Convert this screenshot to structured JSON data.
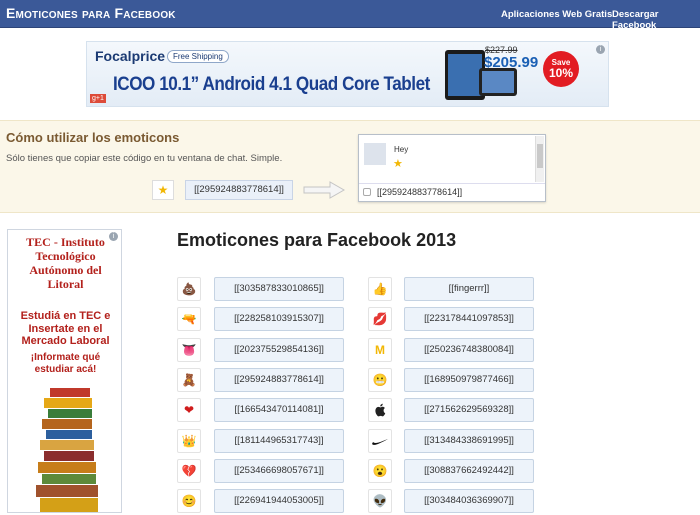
{
  "header": {
    "logo": "Emoticones para Facebook",
    "nav": [
      "Aplicaciones Web Gratis",
      "Descargar Facebook"
    ]
  },
  "banner_ad": {
    "brand": "Focalprice",
    "shipping": "Free Shipping",
    "headline": "ICOO 10.1” Android 4.1 Quad Core Tablet",
    "price_old": "$227.99",
    "price_new": "$205.99",
    "save_label": "Save",
    "save_value": "10%",
    "gplus": "g+1"
  },
  "howto": {
    "title": "Cómo utilizar los emoticons",
    "subtitle": "Sólo tienes que copiar este código en tu ventana de chat. Simple.",
    "demo_code": "[[295924883778614]]",
    "chat_name": "Hey",
    "chat_input": "[[295924883778614]]"
  },
  "side_ad": {
    "title": "TEC - Instituto Tecnológico Autónomo del Litoral",
    "body": "Estudiá en TEC e Insertate en el Mercado Laboral",
    "cta": "¡Informate qué estudiar acá!"
  },
  "main": {
    "title": "Emoticones para Facebook 2013",
    "left": [
      {
        "icon": "poop-icon",
        "glyph": "💩",
        "code": "[[303587833010865]]"
      },
      {
        "icon": "gun-icon",
        "glyph": "🔫",
        "code": "[[228258103915307]]"
      },
      {
        "icon": "rolling-stones-icon",
        "glyph": "👅",
        "code": "[[202375529854136]]"
      },
      {
        "icon": "teddy-bear-icon",
        "glyph": "🧸",
        "code": "[[295924883778614]]"
      },
      {
        "icon": "heart-icon",
        "glyph": "❤",
        "code": "[[166543470114081]]"
      },
      {
        "icon": "crown-icon",
        "glyph": "👑",
        "code": "[[181144965317743]]"
      },
      {
        "icon": "broken-heart-icon",
        "glyph": "💔",
        "code": "[[253466698057671]]"
      },
      {
        "icon": "smiley-icon",
        "glyph": "😊",
        "code": "[[226941944053005]]"
      }
    ],
    "right": [
      {
        "icon": "finger-icon",
        "glyph": "👍",
        "code": "[[fingerrr]]"
      },
      {
        "icon": "kissing-lips-icon",
        "glyph": "💋",
        "code": "[[223178441097853]]"
      },
      {
        "icon": "mcdonalds-icon",
        "glyph": "M",
        "code": "[[250236748380084]]"
      },
      {
        "icon": "troll-face-icon",
        "glyph": "😬",
        "code": "[[168950979877466]]"
      },
      {
        "icon": "apple-icon",
        "glyph": "",
        "code": "[[271562629569328]]"
      },
      {
        "icon": "nike-swoosh-icon",
        "glyph": "✓",
        "code": "[[313484338691995]]"
      },
      {
        "icon": "surprised-face-icon",
        "glyph": "😮",
        "code": "[[308837662492442]]"
      },
      {
        "icon": "alien-icon",
        "glyph": "👽",
        "code": "[[303484036369907]]"
      }
    ]
  }
}
